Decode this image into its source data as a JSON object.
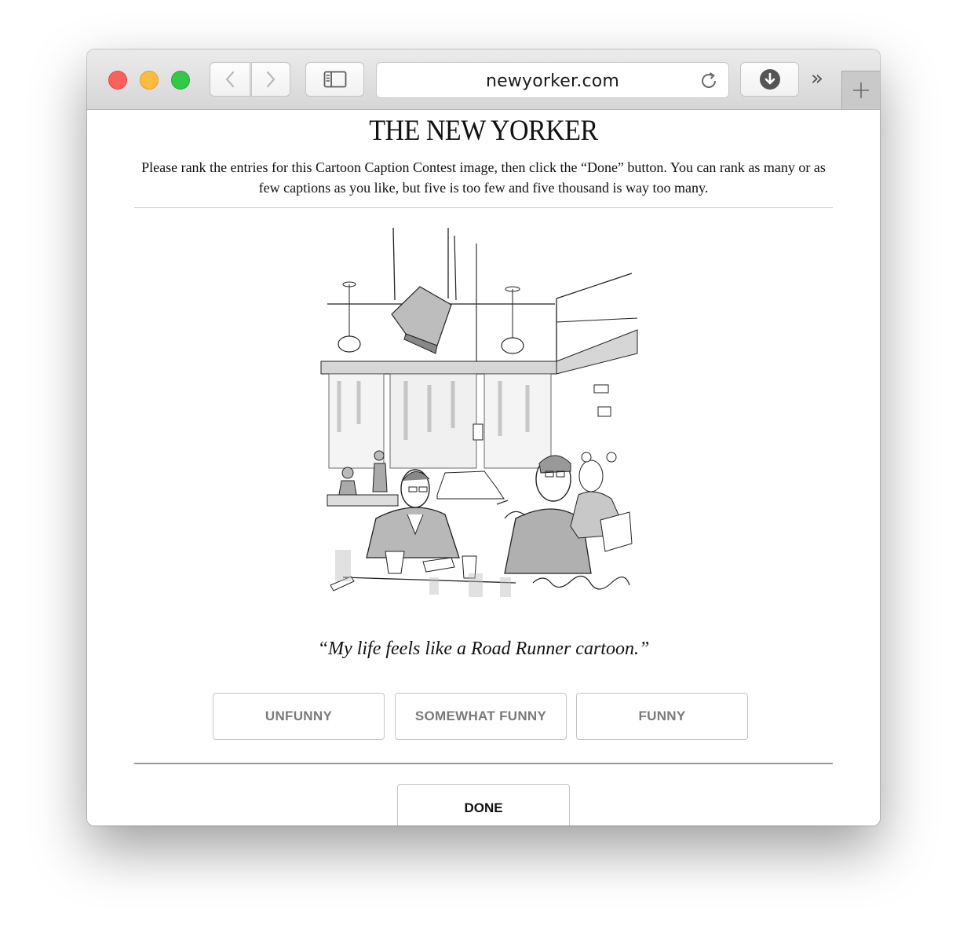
{
  "browser": {
    "address": "newyorker.com",
    "icons": {
      "back": "chevron-left-icon",
      "forward": "chevron-right-icon",
      "sidebar": "sidebar-icon",
      "reload": "reload-icon",
      "download": "download-icon",
      "overflow": "double-chevron-icon",
      "new_tab": "plus-icon"
    },
    "overflow_glyph": "»"
  },
  "page": {
    "masthead": "THE NEW YORKER",
    "instructions": "Please rank the entries for this Cartoon Caption Contest image, then click the “Done” button. You can rank as many or as few captions as you like, but five is too few and five thousand is way too many.",
    "caption": "“My life feels like a Road Runner cartoon.”",
    "buttons": {
      "unfunny": "UNFUNNY",
      "somewhat_funny": "SOMEWHAT FUNNY",
      "funny": "FUNNY",
      "done": "DONE"
    }
  },
  "colors": {
    "close": "#fc605c",
    "minimize": "#fdbc40",
    "maximize": "#34c84a"
  }
}
